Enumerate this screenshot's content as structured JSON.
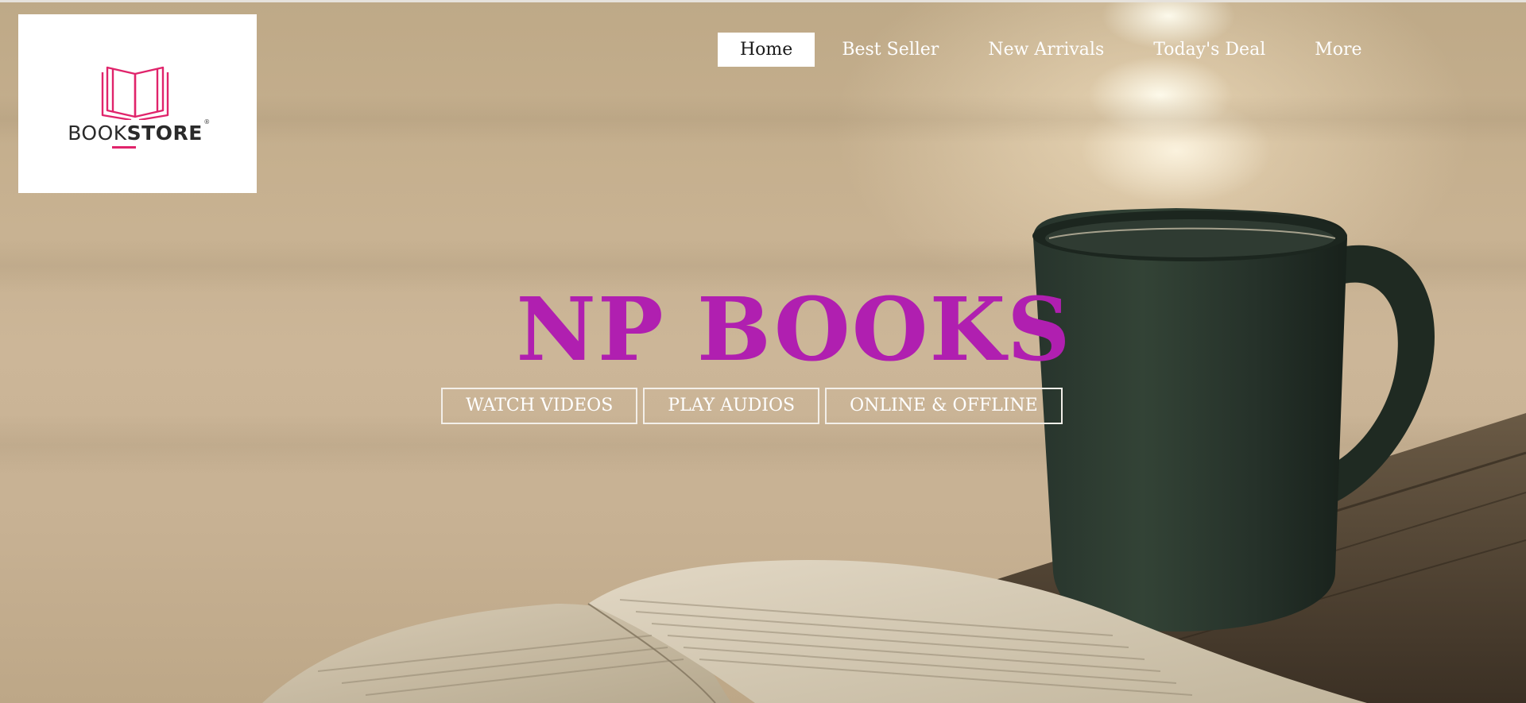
{
  "logo": {
    "word_light": "BOOK",
    "word_bold": "STORE",
    "registered": "®",
    "accent_color": "#e0246b"
  },
  "nav": {
    "items": [
      {
        "label": "Home",
        "active": true
      },
      {
        "label": "Best Seller",
        "active": false
      },
      {
        "label": "New Arrivals",
        "active": false
      },
      {
        "label": "Today's Deal",
        "active": false
      },
      {
        "label": "More",
        "active": false
      }
    ]
  },
  "hero": {
    "title": "NP BOOKS",
    "title_color": "#b01fb0",
    "background_image": "coffee-mug-and-open-book-by-water",
    "buttons": [
      {
        "label": "WATCH VIDEOS"
      },
      {
        "label": "PLAY AUDIOS"
      },
      {
        "label": "ONLINE & OFFLINE"
      }
    ]
  }
}
